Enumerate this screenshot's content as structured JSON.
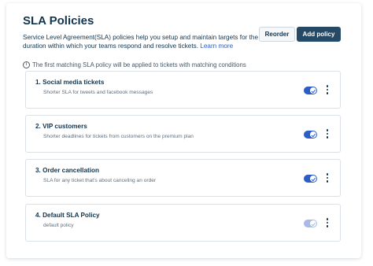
{
  "header": {
    "title": "SLA Policies",
    "description": "Service Level Agreement(SLA) policies help you setup and maintain targets for the duration within which your teams respond and resolve tickets.",
    "learn_more": "Learn more",
    "reorder_label": "Reorder",
    "add_label": "Add policy"
  },
  "info": {
    "icon": "info-circle-icon",
    "text": "The first matching SLA policy will be applied to tickets with matching conditions"
  },
  "policies": [
    {
      "name": "1. Social media tickets",
      "description": "Shorter SLA for tweets and facebook messages",
      "enabled": true
    },
    {
      "name": "2. VIP customers",
      "description": "Shorter deadlines for tickets from customers on the premium plan",
      "enabled": true
    },
    {
      "name": "3. Order cancellation",
      "description": "SLA for any ticket that's about canceling an order",
      "enabled": true
    },
    {
      "name": "4. Default SLA Policy",
      "description": "default policy",
      "enabled": true,
      "locked": true
    }
  ],
  "colors": {
    "primary_button": "#264966",
    "toggle_on": "#2c5cc5",
    "toggle_disabled": "#a9bbe4",
    "link": "#2c5cc5"
  }
}
